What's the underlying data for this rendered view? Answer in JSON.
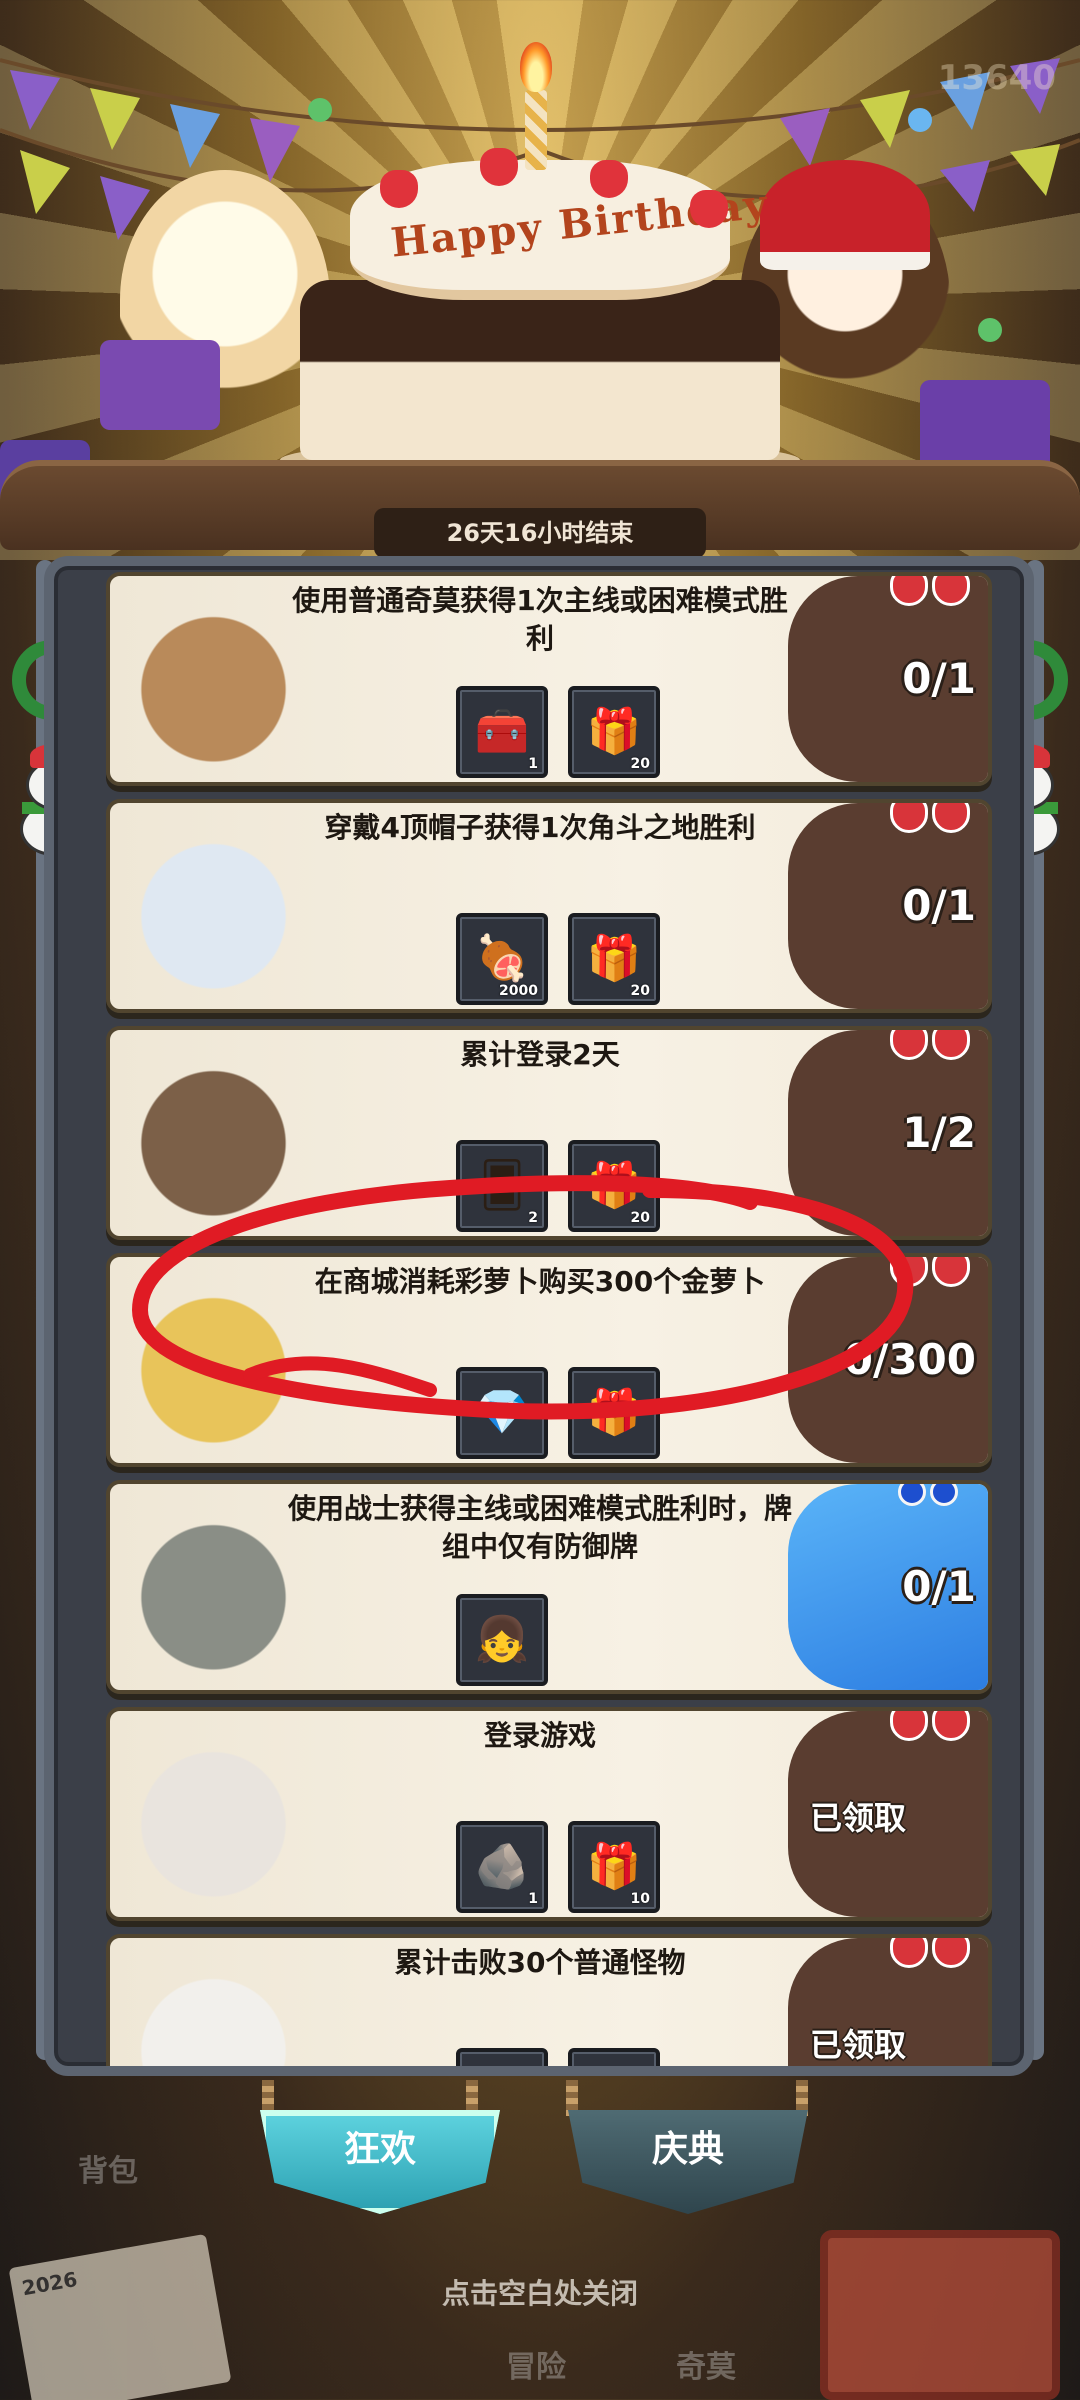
{
  "header": {
    "score_text": "13640",
    "cake_text": "Happy Birthday",
    "timer": "26天16小时结束"
  },
  "tasks": [
    {
      "title": "使用普通奇莫获得1次主线或困难模式胜利",
      "status": "0/1",
      "rewards": [
        {
          "icon": "treasure-chest-icon",
          "qty": "1"
        },
        {
          "icon": "gift-box-icon",
          "qty": "20"
        }
      ],
      "theme": "brown"
    },
    {
      "title": "穿戴4顶帽子获得1次角斗之地胜利",
      "status": "0/1",
      "rewards": [
        {
          "icon": "meat-icon",
          "qty": "2000"
        },
        {
          "icon": "gift-box-icon",
          "qty": "20"
        }
      ],
      "theme": "brown"
    },
    {
      "title": "累计登录2天",
      "status": "1/2",
      "rewards": [
        {
          "icon": "blue-card-icon",
          "qty": "2"
        },
        {
          "icon": "gift-box-icon",
          "qty": "20"
        }
      ],
      "theme": "brown"
    },
    {
      "title": "在商城消耗彩萝卜购买300个金萝卜",
      "status": "0/300",
      "rewards": [
        {
          "icon": "blue-crystal-icon",
          "qty": ""
        },
        {
          "icon": "gift-box-icon",
          "qty": ""
        }
      ],
      "theme": "brown"
    },
    {
      "title": "使用战士获得主线或困难模式胜利时，牌组中仅有防御牌",
      "status": "0/1",
      "rewards": [
        {
          "icon": "character-portrait-icon",
          "qty": ""
        }
      ],
      "theme": "blue"
    },
    {
      "title": "登录游戏",
      "status": "已领取",
      "rewards": [
        {
          "icon": "gray-rune-icon",
          "qty": "1"
        },
        {
          "icon": "silver-gift-icon",
          "qty": "10"
        }
      ],
      "theme": "brown"
    },
    {
      "title": "累计击败30个普通怪物",
      "status": "已领取",
      "rewards": [
        {
          "icon": "gray-item-icon",
          "qty": ""
        },
        {
          "icon": "silver-gift-icon",
          "qty": ""
        }
      ],
      "theme": "brown"
    }
  ],
  "tabs": {
    "carnival": "狂欢",
    "celebration": "庆典"
  },
  "background_ui": {
    "bag_label": "背包",
    "adventure_label": "冒险",
    "qimo_label": "奇莫",
    "newspaper_year": "2026"
  },
  "close_hint": "点击空白处关闭",
  "colors": {
    "panel_border": "#5c6470",
    "card_bg": "#f3ebdb",
    "wave_brown": "#5a3d30",
    "wave_blue": "#2d7ee2",
    "tab_active": "#2b9fb0",
    "annotation_red": "#e01b24"
  }
}
